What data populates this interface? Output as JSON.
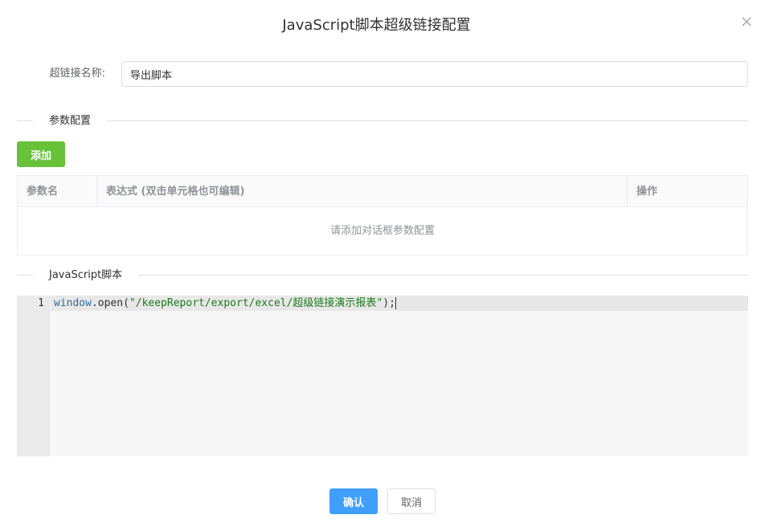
{
  "dialog": {
    "title": "JavaScript脚本超级链接配置",
    "close_icon": "close-icon"
  },
  "form": {
    "name_label": "超链接名称:",
    "name_value": "导出脚本"
  },
  "params_section": {
    "title": "参数配置",
    "add_button": "添加",
    "table": {
      "columns": [
        "参数名",
        "表达式 (双击单元格也可编辑)",
        "操作"
      ],
      "rows": [],
      "empty_text": "请添加对话框参数配置"
    }
  },
  "script_section": {
    "title": "JavaScript脚本",
    "editor": {
      "lines": [
        {
          "number": "1",
          "tokens": {
            "var": "window",
            "dot": ".",
            "method": "open",
            "open_paren": "(",
            "string": "\"/keepReport/export/excel/超级链接演示报表\"",
            "close": ");"
          }
        }
      ]
    }
  },
  "footer": {
    "confirm_button": "确认",
    "cancel_button": "取消"
  },
  "colors": {
    "primary": "#409eff",
    "success": "#67c23a",
    "border": "#dcdfe6",
    "string_token": "#1a7b1a",
    "variable_token": "#2f6f9f"
  }
}
